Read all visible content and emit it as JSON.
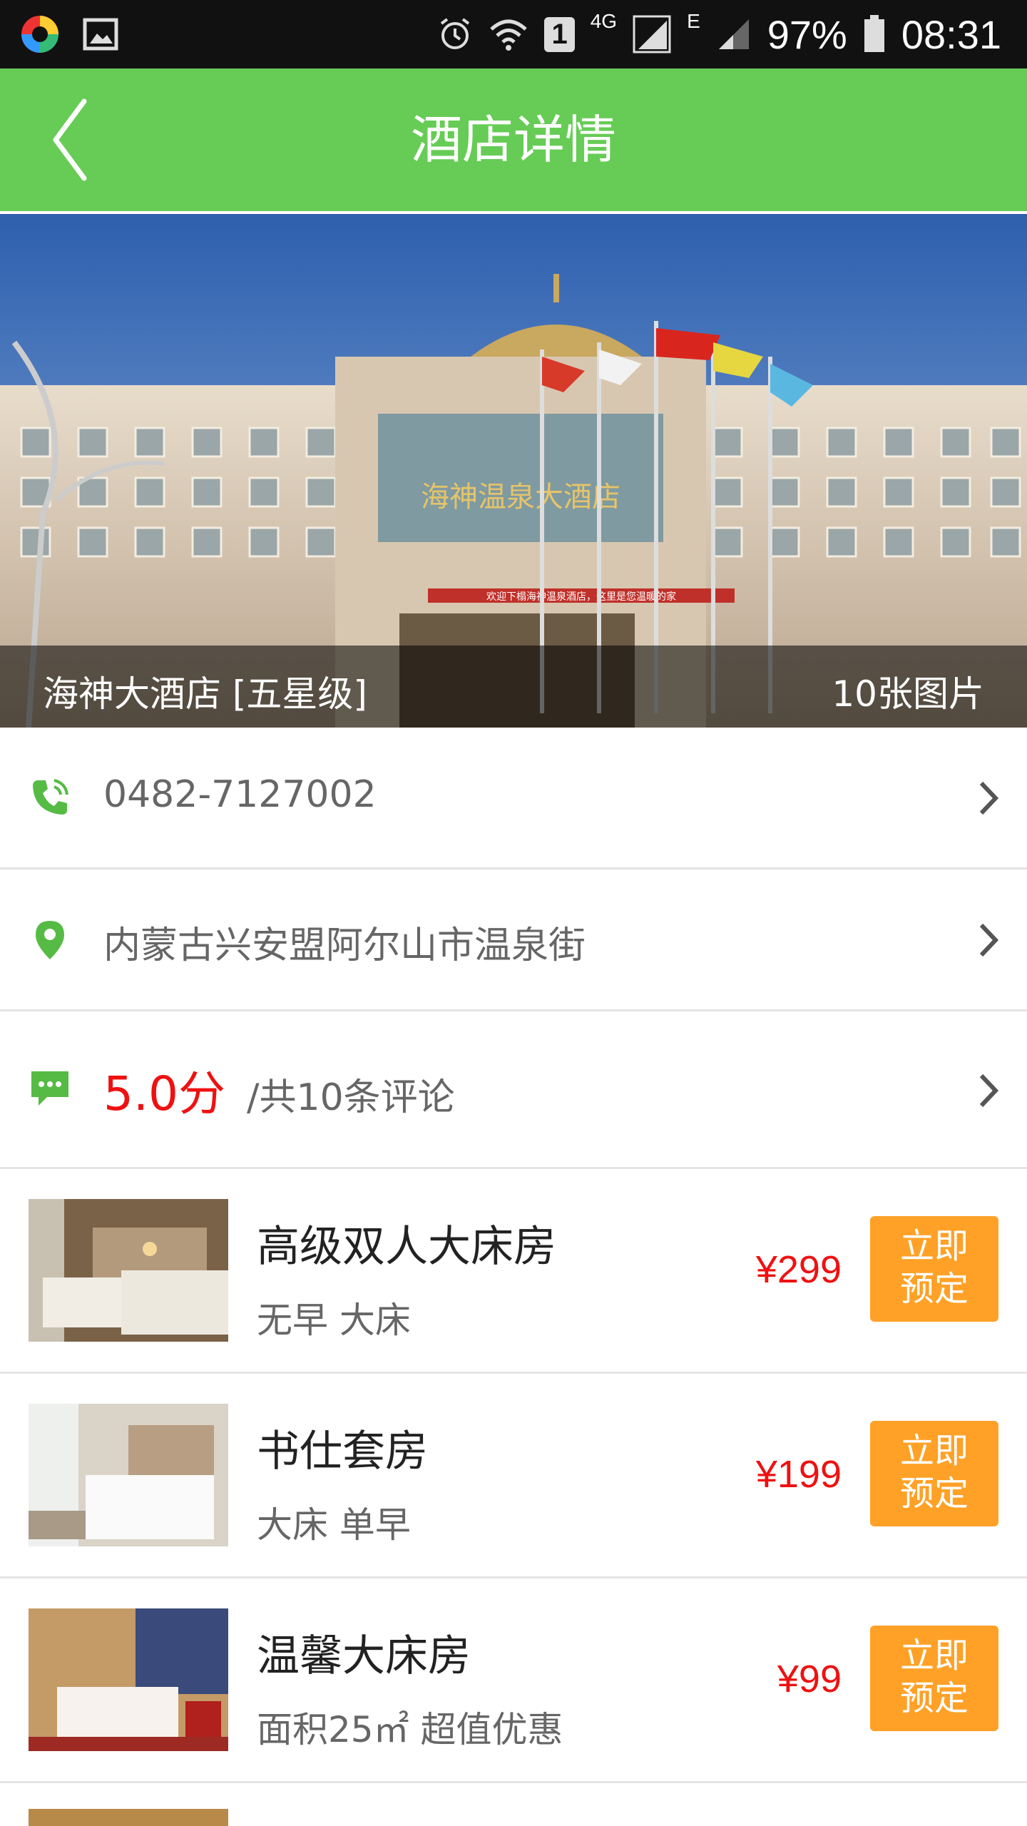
{
  "status_bar": {
    "battery": "97%",
    "time": "08:31",
    "network_4g": "4G",
    "network_e": "E",
    "sim": "1"
  },
  "header": {
    "title": "酒店详情"
  },
  "hero": {
    "hotel_name": "海神大酒店 [五星级]",
    "photo_count": "10张图片",
    "sign_text": "海神温泉大酒店",
    "banner_text": "欢迎下榻海神温泉酒店，这里是您温暖的家"
  },
  "info": {
    "phone": "0482-7127002",
    "address": "内蒙古兴安盟阿尔山市温泉街",
    "score": "5.0分",
    "reviews": "/共10条评论"
  },
  "rooms": [
    {
      "name": "高级双人大床房",
      "desc": "无早 大床",
      "price": "¥299",
      "book_line1": "立即",
      "book_line2": "预定"
    },
    {
      "name": "书仕套房",
      "desc": "大床 单早",
      "price": "¥199",
      "book_line1": "立即",
      "book_line2": "预定"
    },
    {
      "name": "温馨大床房",
      "desc": "面积25㎡ 超值优惠",
      "price": "¥99",
      "book_line1": "立即",
      "book_line2": "预定"
    }
  ],
  "colors": {
    "header": "#66cc55",
    "price": "#ee1111",
    "book_button": "#ffa126",
    "icon": "#55bb44"
  }
}
